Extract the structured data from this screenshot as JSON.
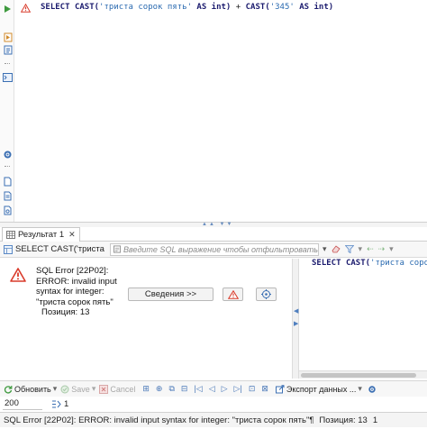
{
  "editor": {
    "tokens": {
      "select": "SELECT",
      "cast1": "CAST(",
      "str1": "'триста сорок пять'",
      "as1": "AS",
      "int1": "int)",
      "plus": "+",
      "cast2": "CAST(",
      "str2": "'345'",
      "as2": "AS",
      "int2": "int)"
    }
  },
  "results_tab": {
    "label": "Результат 1",
    "close": "✕"
  },
  "filter_bar": {
    "query_label": "SELECT CAST('триста",
    "filter_placeholder": "Введите SQL выражение чтобы отфильтровать"
  },
  "error": {
    "message": "SQL Error [22P02]: ERROR: invalid input syntax for integer: \"триста сорок пять\"",
    "position": "Позиция: 13",
    "details_button": "Сведения >>"
  },
  "side_panel": {
    "tokens": {
      "select": "SELECT",
      "cast": "CAST(",
      "str": "'триста сорок"
    }
  },
  "bottom_toolbar": {
    "refresh": "Обновить",
    "save": "Save",
    "cancel": "Cancel",
    "export": "Экспорт данных ..."
  },
  "fetch": {
    "count": "200",
    "rows": "1"
  },
  "status": {
    "text": "SQL Error [22P02]: ERROR: invalid input syntax for integer: \"триста сорок пять\"¶",
    "position": "Позиция: 13",
    "row": "1"
  },
  "colors": {
    "keyword": "#1b1b6e",
    "string": "#2a6ab0",
    "error_red": "#d93b2b",
    "accent_blue": "#4a78b8"
  }
}
